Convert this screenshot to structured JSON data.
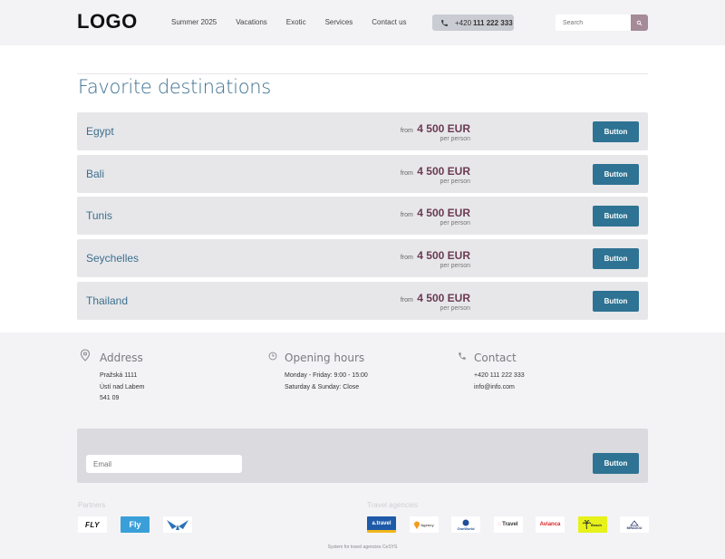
{
  "header": {
    "logo": "LOGO",
    "nav": [
      "Summer 2025",
      "Vacations",
      "Exotic",
      "Services",
      "Contact us"
    ],
    "phone_prefix": "+420",
    "phone_number": "111 222 333",
    "search_placeholder": "Search"
  },
  "main": {
    "title": "Favorite destinations",
    "price_from": "from",
    "price_per": "per person",
    "button_label": "Button",
    "destinations": [
      {
        "name": "Egypt",
        "price": "4 500 EUR"
      },
      {
        "name": "Bali",
        "price": "4 500 EUR"
      },
      {
        "name": "Tunis",
        "price": "4 500 EUR"
      },
      {
        "name": "Seychelles",
        "price": "4 500 EUR"
      },
      {
        "name": "Thailand",
        "price": "4 500 EUR"
      }
    ]
  },
  "footer": {
    "address": {
      "title": "Address",
      "lines": [
        "Pražská 1111",
        "Ústí nad Labem",
        "541 09"
      ],
      "icon": "map-pin-icon"
    },
    "hours": {
      "title": "Opening hours",
      "lines": [
        "Monday - Friday:  9:00  - 15:00",
        "Saturday & Sunday: Close"
      ],
      "icon": "clock-icon"
    },
    "contact": {
      "title": "Contact",
      "lines": [
        "+420 111 222 333",
        "info@info.com"
      ],
      "icon": "phone-icon"
    },
    "newsletter": {
      "placeholder": "Email",
      "button_label": "Button"
    },
    "partners_label": "Partners",
    "partners": [
      "FLY",
      "Fly",
      ""
    ],
    "agencies_label": "Travel agencies",
    "agencies": [
      "a.travel",
      "Agency",
      "OneWorld",
      "Travel",
      "Avianca",
      "Beach",
      "MIRADOU"
    ],
    "copyright": "System for travel agencies CeSYS"
  },
  "colors": {
    "accent": "#2e7393",
    "price": "#6b3a52",
    "title": "#3d7090",
    "search_button": "#a58a97"
  }
}
